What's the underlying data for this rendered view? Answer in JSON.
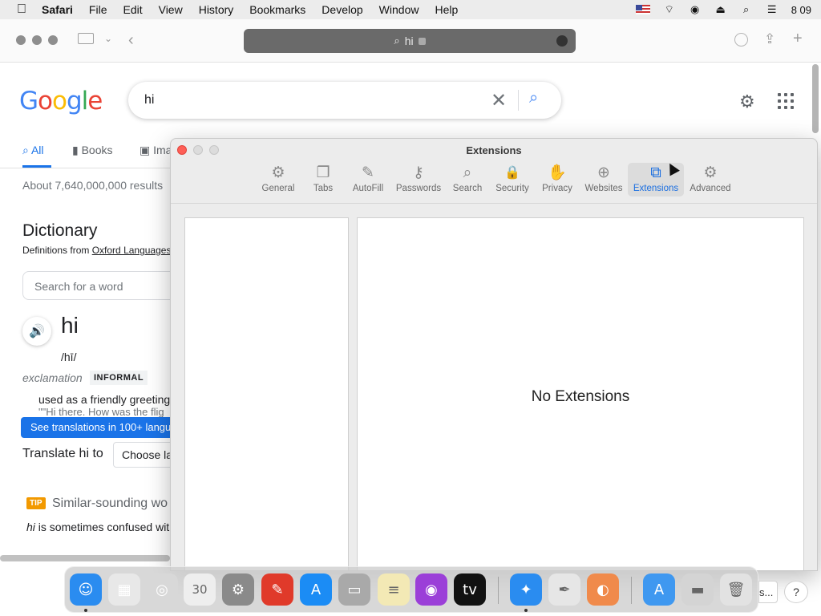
{
  "menubar": {
    "app_name": "Safari",
    "menus": [
      "File",
      "Edit",
      "View",
      "History",
      "Bookmarks",
      "Develop",
      "Window",
      "Help"
    ],
    "clock": "8 09",
    "icons": [
      "apple-logo-icon",
      "flag-us-icon",
      "wifi-icon",
      "user-icon",
      "eject-icon",
      "spotlight-search-icon",
      "control-center-icon"
    ]
  },
  "safari": {
    "url_text": "hi",
    "icons": [
      "sidebar-icon",
      "chevron-down-icon",
      "back-arrow-icon",
      "download-icon",
      "share-icon",
      "new-tab-plus-icon"
    ]
  },
  "google": {
    "logo": [
      "G",
      "o",
      "o",
      "g",
      "l",
      "e"
    ],
    "query": "hi",
    "tabs": [
      {
        "label": "All",
        "active": true
      },
      {
        "label": "Books",
        "active": false
      },
      {
        "label": "Ima",
        "active": false
      }
    ],
    "results_count": "About 7,640,000,000 results",
    "dictionary": {
      "title": "Dictionary",
      "definitions_from": "Definitions from",
      "source": "Oxford Languages",
      "search_placeholder": "Search for a word",
      "word": "hi",
      "phonetic": "/hī/",
      "part_of_speech": "exclamation",
      "register": "INFORMAL",
      "definition": "used as a friendly greeting",
      "example": "\"\"Hi there. How was the flig",
      "translate_pill": "See translations in 100+ langu",
      "translate_label": "Translate hi to",
      "choose_language": "Choose la"
    },
    "tip": {
      "badge": "TIP",
      "heading": "Similar-sounding wo",
      "word": "hi",
      "text": " is sometimes confused wit"
    }
  },
  "prefs_window": {
    "title": "Extensions",
    "tabs": [
      {
        "label": "General",
        "icon": "gear-icon",
        "glyph": "⚙",
        "active": false
      },
      {
        "label": "Tabs",
        "icon": "tabs-icon",
        "glyph": "❐",
        "active": false
      },
      {
        "label": "AutoFill",
        "icon": "autofill-icon",
        "glyph": "✎",
        "active": false
      },
      {
        "label": "Passwords",
        "icon": "key-icon",
        "glyph": "⚷",
        "active": false
      },
      {
        "label": "Search",
        "icon": "magnifier-icon",
        "glyph": "⌕",
        "active": false
      },
      {
        "label": "Security",
        "icon": "lock-icon",
        "glyph": "🔒",
        "active": false
      },
      {
        "label": "Privacy",
        "icon": "hand-icon",
        "glyph": "✋",
        "active": false
      },
      {
        "label": "Websites",
        "icon": "globe-icon",
        "glyph": "⊕",
        "active": false
      },
      {
        "label": "Extensions",
        "icon": "puzzle-icon",
        "glyph": "⧉",
        "active": true
      },
      {
        "label": "Advanced",
        "icon": "gears-icon",
        "glyph": "⚙",
        "active": false
      }
    ],
    "empty_message": "No Extensions"
  },
  "dock": {
    "items": [
      {
        "name": "finder-icon",
        "color": "#2a8cf0",
        "glyph": "☺",
        "running": true
      },
      {
        "name": "launchpad-icon",
        "color": "#e8e8e8",
        "glyph": "▦",
        "running": false
      },
      {
        "name": "chrome-icon",
        "color": "#d8d8d8",
        "glyph": "◎",
        "running": false
      },
      {
        "name": "calendar-icon",
        "color": "#eeeeee",
        "glyph": "30",
        "running": false
      },
      {
        "name": "system-preferences-icon",
        "color": "#8a8a8a",
        "glyph": "⚙",
        "running": false
      },
      {
        "name": "script-editor-icon",
        "color": "#e03a2a",
        "glyph": "✎",
        "running": false
      },
      {
        "name": "app-store-icon",
        "color": "#1b8cf5",
        "glyph": "A",
        "running": false
      },
      {
        "name": "terminal-icon",
        "color": "#a9a9a9",
        "glyph": "▭",
        "running": false
      },
      {
        "name": "notes-icon",
        "color": "#f3e9b5",
        "glyph": "≡",
        "running": false
      },
      {
        "name": "podcasts-icon",
        "color": "#9b3fd8",
        "glyph": "◉",
        "running": false
      },
      {
        "name": "apple-tv-icon",
        "color": "#111111",
        "glyph": "tv",
        "running": false
      },
      {
        "name": "safari-icon",
        "color": "#2a8cf0",
        "glyph": "✦",
        "running": true
      },
      {
        "name": "textedit-icon",
        "color": "#e6e6e6",
        "glyph": "✒",
        "running": false
      },
      {
        "name": "firefox-icon",
        "color": "#f08a4b",
        "glyph": "◐",
        "running": false
      },
      {
        "name": "app-store-folder-icon",
        "color": "#3f98f0",
        "glyph": "A",
        "running": false
      },
      {
        "name": "disk-icon",
        "color": "#d4d4d4",
        "glyph": "▬",
        "running": false
      },
      {
        "name": "trash-icon",
        "color": "#e2e2e2",
        "glyph": "🗑",
        "running": false
      }
    ],
    "behind_text": "s...",
    "help_label": "?"
  }
}
